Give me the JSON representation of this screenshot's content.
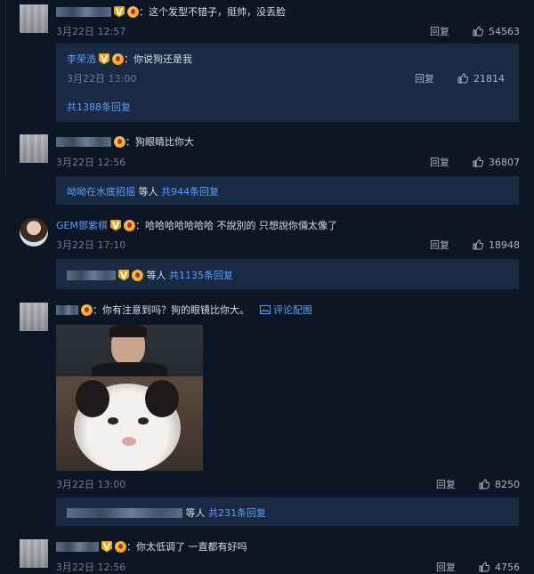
{
  "comments": [
    {
      "text": "：这个发型不错子，挺帅，没丢脸",
      "time": "3月22日 12:57",
      "reply": "回复",
      "likes": "54563",
      "sub_reply": {
        "user": "李荣浩",
        "text": "：你说狗还是我",
        "time": "3月22日 13:00",
        "reply": "回复",
        "likes": "21814",
        "more": "共1388条回复"
      }
    },
    {
      "text": "：狗眼睛比你大",
      "time": "3月22日 12:56",
      "reply": "回复",
      "likes": "36807",
      "summary_user": "呦呦在水底招摇",
      "summary_mid": " 等人 ",
      "summary_more": "共944条回复"
    },
    {
      "user": "GEM鄧紫棋",
      "text": "：哈哈哈哈哈哈哈 不說別的 只想說你倆太像了",
      "time": "3月22日 17:10",
      "reply": "回复",
      "likes": "18948",
      "summary_mid": " 等人 ",
      "summary_more": "共1135条回复"
    },
    {
      "text": "：你有注意到吗？狗的眼镜比你大。",
      "pic_link": "评论配图",
      "time": "3月22日 13:00",
      "reply": "回复",
      "likes": "8250",
      "summary_mid": " 等人 ",
      "summary_more": "共231条回复"
    },
    {
      "text": "：你太低调了 一直都有好吗",
      "time": "3月22日 12:56",
      "reply": "回复",
      "likes": "4756"
    }
  ],
  "colors": {
    "background": "#0d1624",
    "link": "#5b9ef8",
    "subpanel": "#1a2a44",
    "badge_v": "#e8a516"
  },
  "icons": [
    "like-icon",
    "vip-v-badge",
    "member-badge",
    "image-icon"
  ]
}
